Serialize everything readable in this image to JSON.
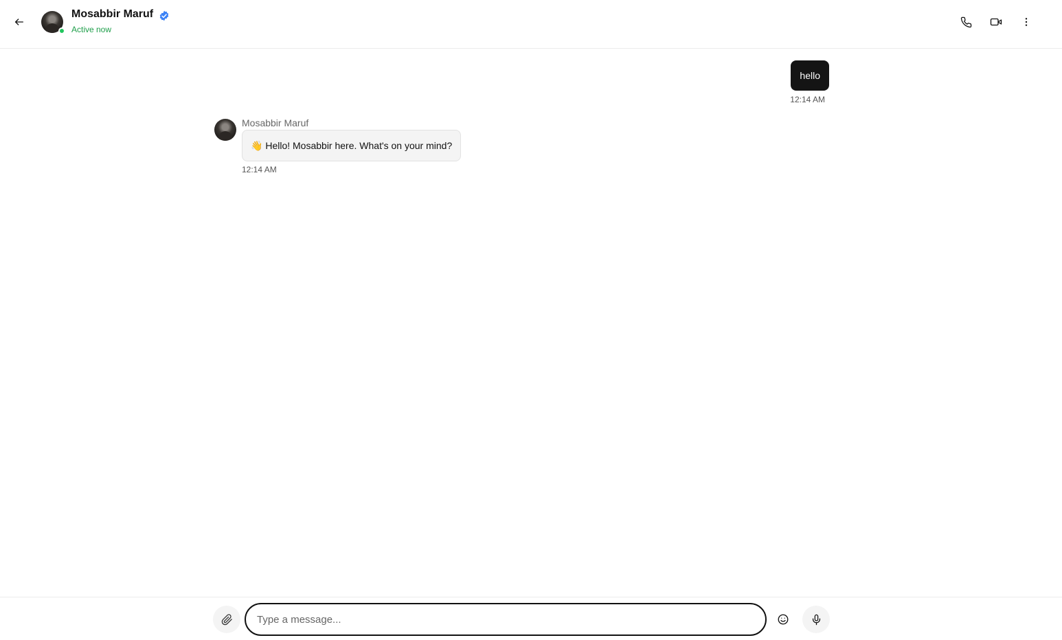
{
  "header": {
    "contact_name": "Mosabbir Maruf",
    "presence": "Active now"
  },
  "messages": [
    {
      "direction": "sent",
      "text": "hello",
      "time": "12:14 AM"
    },
    {
      "direction": "received",
      "sender": "Mosabbir Maruf",
      "emoji": "👋",
      "text": "Hello! Mosabbir here. What's on your mind?",
      "time": "12:14 AM"
    }
  ],
  "composer": {
    "placeholder": "Type a message...",
    "value": ""
  },
  "colors": {
    "sent_bubble": "#141414",
    "received_bubble": "#f4f4f4",
    "presence_green": "#1e9e4a",
    "verified_blue": "#3b82f6"
  },
  "icons": [
    "arrow-left-icon",
    "verified-badge-icon",
    "phone-icon",
    "video-camera-icon",
    "more-vertical-icon",
    "paperclip-icon",
    "smiley-icon",
    "microphone-icon"
  ]
}
